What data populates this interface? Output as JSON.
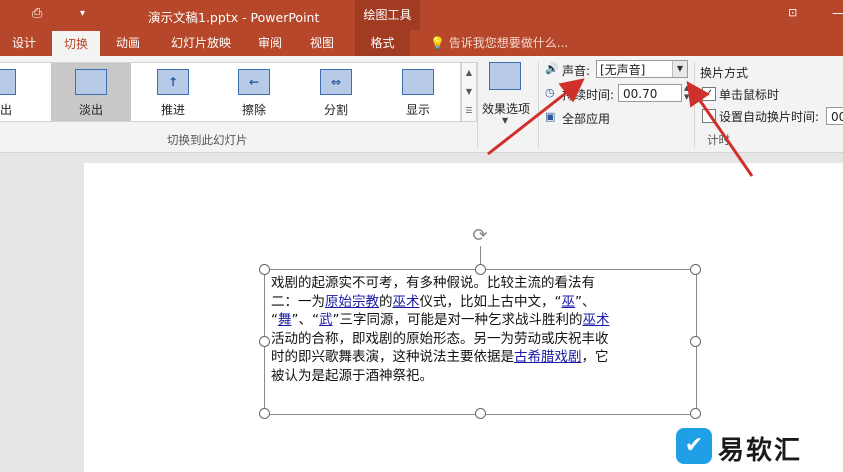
{
  "titlebar": {
    "title": "演示文稿1.pptx - PowerPoint",
    "tools_tab": "绘图工具"
  },
  "tabs": [
    {
      "label": "设计"
    },
    {
      "label": "切换"
    },
    {
      "label": "动画"
    },
    {
      "label": "幻灯片放映"
    },
    {
      "label": "审阅"
    },
    {
      "label": "视图"
    },
    {
      "label": "格式"
    }
  ],
  "tellme": "告诉我您想要做什么...",
  "gallery": {
    "items": [
      "切出",
      "淡出",
      "推进",
      "擦除",
      "分割",
      "显示"
    ],
    "selected": "淡出",
    "group_label": "切换到此幻灯片"
  },
  "effects": {
    "label": "效果选项"
  },
  "timing": {
    "sound_label": "声音:",
    "sound_value": "[无声音]",
    "duration_label": "持续时间:",
    "duration_value": "00.70",
    "apply_all_label": "全部应用",
    "advance_label": "换片方式",
    "on_click_label": "单击鼠标时",
    "on_click_checked": true,
    "auto_label": "设置自动换片时间:",
    "auto_value": "00",
    "group_label": "计时"
  },
  "slide": {
    "line1": "戏剧的起源实不可考，有多种假说。比较主流的看法有",
    "line2a": "二：一为",
    "line2_link1": "原始宗教",
    "line2b": "的",
    "line2_link2": "巫术",
    "line2c": "仪式，比如上古中文，“",
    "line2_link3": "巫",
    "line2d": "”、",
    "line3a": "“",
    "line3_link1": "舞",
    "line3b": "”、“",
    "line3_link2": "武",
    "line3c": "”三字同源，可能是对一种乞求战斗胜利的",
    "line3_link3": "巫术",
    "line4": "活动的合称，即戏剧的原始形态。另一为劳动或庆祝丰收",
    "line5a": "时的即兴歌舞表演，这种说法主要依据是",
    "line5_link": "古希腊戏剧",
    "line5b": "，它",
    "line6": "被认为是起源于酒神祭祀。"
  },
  "watermark": {
    "text": "易软汇"
  },
  "colors": {
    "ppt_accent": "#b7472a",
    "link": "#1a1aa6",
    "arrow": "#d0302b"
  }
}
